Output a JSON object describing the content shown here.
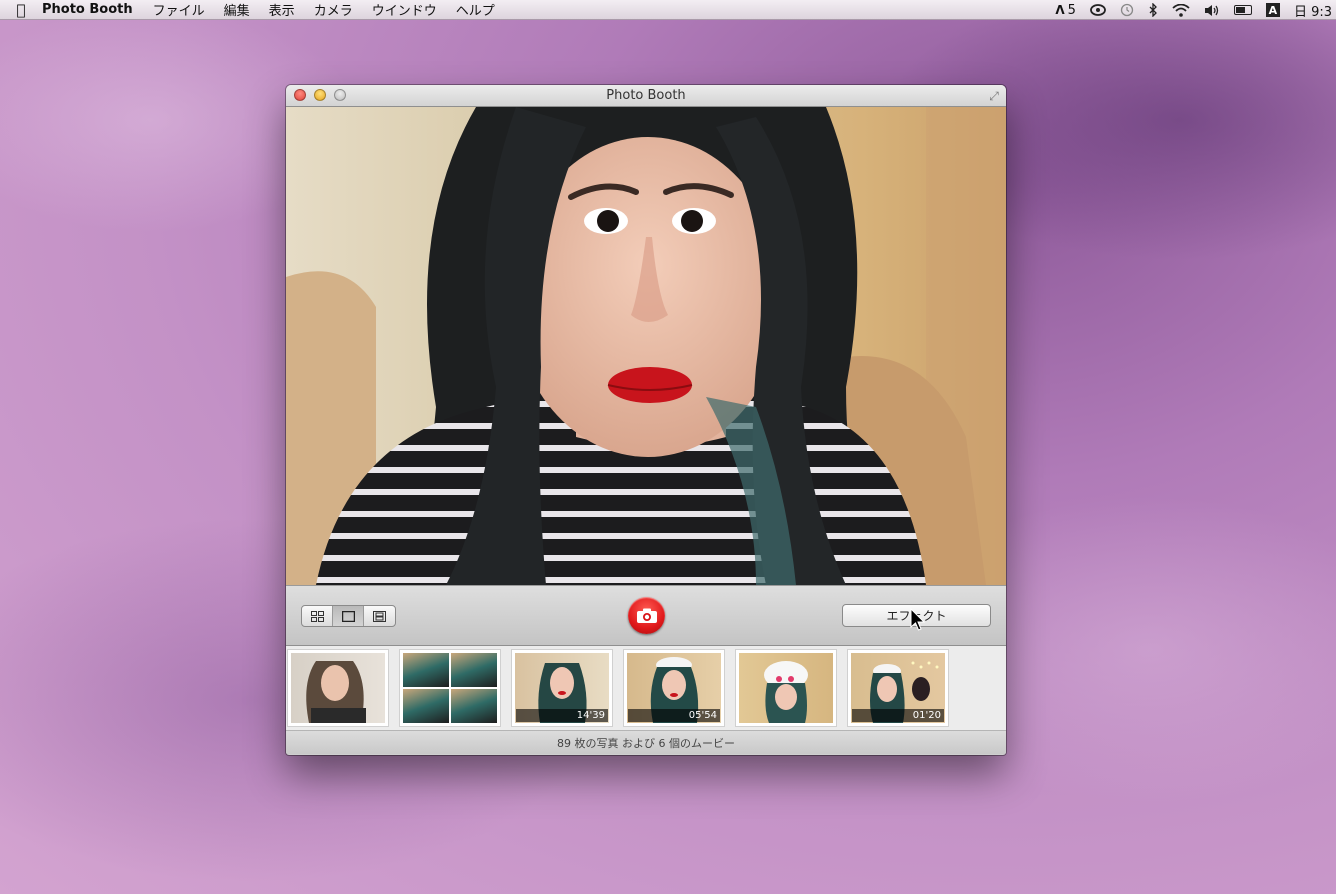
{
  "menubar": {
    "apple_icon": "apple-logo-icon",
    "app_name": "Photo Booth",
    "menus": [
      "ファイル",
      "編集",
      "表示",
      "カメラ",
      "ウインドウ",
      "ヘルプ"
    ],
    "status": {
      "adobe_count": "5",
      "date_time": "日 9:3"
    }
  },
  "window": {
    "title": "Photo Booth",
    "toolbar": {
      "view_modes": [
        "grid-4-icon",
        "single-frame-icon",
        "film-strip-icon"
      ],
      "active_view": 1,
      "effects_label": "エフェクト"
    },
    "thumbnails": [
      {
        "type": "photo",
        "duration": ""
      },
      {
        "type": "four-up",
        "duration": ""
      },
      {
        "type": "movie",
        "duration": "14'39"
      },
      {
        "type": "movie",
        "duration": "05'54"
      },
      {
        "type": "photo",
        "duration": ""
      },
      {
        "type": "movie",
        "duration": "01'20"
      }
    ],
    "status_text": "89 枚の写真 および 6 個のムービー"
  },
  "colors": {
    "shutter_red": "#e0191b",
    "desktop_purple": "#b07bb8"
  }
}
